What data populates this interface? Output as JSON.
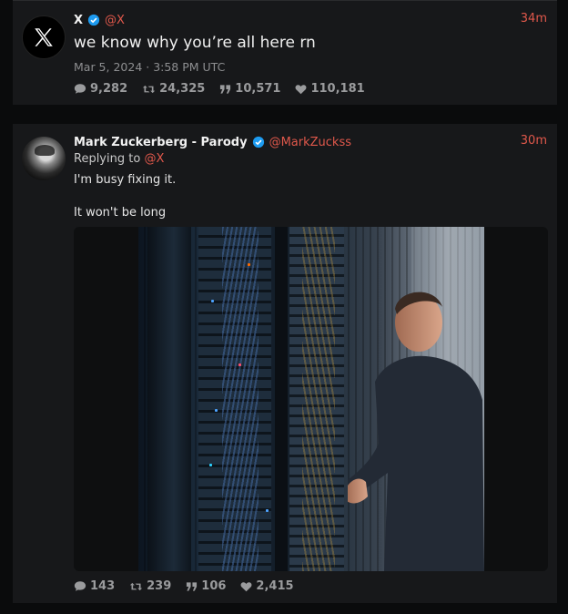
{
  "tweets": [
    {
      "author_name": "X",
      "handle": "@X",
      "time": "34m",
      "text": "we know why you’re all here rn",
      "date": "Mar 5, 2024 · 3:58 PM UTC",
      "stats": {
        "replies": "9,282",
        "retweets": "24,325",
        "quotes": "10,571",
        "likes": "110,181"
      }
    },
    {
      "author_name": "Mark Zuckerberg - Parody",
      "handle": "@MarkZuckss",
      "time": "30m",
      "replying_label": "Replying to",
      "replying_handle": "@X",
      "text_line1": "I'm busy fixing it.",
      "text_line2": "It won't be long",
      "stats": {
        "replies": "143",
        "retweets": "239",
        "quotes": "106",
        "likes": "2,415"
      }
    }
  ],
  "icons": [
    "x-logo-icon",
    "verified-icon",
    "comment-icon",
    "retweet-icon",
    "quote-icon",
    "heart-icon"
  ],
  "colors": {
    "accent": "#e0584b",
    "verified": "#1d9bf0",
    "panel": "#17181a",
    "background": "#0a0b0c"
  }
}
